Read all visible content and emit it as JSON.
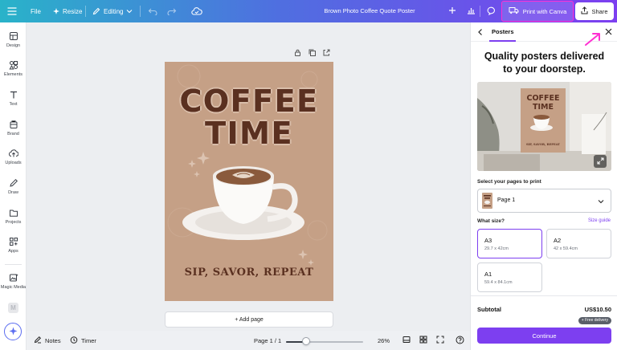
{
  "topbar": {
    "file_label": "File",
    "resize_label": "Resize",
    "editing_label": "Editing",
    "doc_title": "Brown Photo Coffee Quote Poster",
    "print_label": "Print with Canva",
    "share_label": "Share"
  },
  "sidebar": {
    "items": [
      {
        "label": "Design",
        "icon": "design-icon"
      },
      {
        "label": "Elements",
        "icon": "elements-icon"
      },
      {
        "label": "Text",
        "icon": "text-icon"
      },
      {
        "label": "Brand",
        "icon": "brand-icon"
      },
      {
        "label": "Uploads",
        "icon": "uploads-icon"
      },
      {
        "label": "Draw",
        "icon": "draw-icon"
      },
      {
        "label": "Projects",
        "icon": "projects-icon"
      },
      {
        "label": "Apps",
        "icon": "apps-icon"
      },
      {
        "label": "Magic Media",
        "icon": "magic-media-icon"
      }
    ]
  },
  "poster": {
    "title_line1": "COFFEE",
    "title_line2": "TIME",
    "subtitle": "SIP, SAVOR, REPEAT"
  },
  "canvas": {
    "add_page_label": "+ Add page"
  },
  "bottombar": {
    "notes_label": "Notes",
    "timer_label": "Timer",
    "page_indicator": "Page 1 / 1",
    "zoom_label": "26%",
    "zoom_fraction": 0.26
  },
  "panel": {
    "tab_label": "Posters",
    "headline_line1": "Quality posters delivered",
    "headline_line2": "to your doorstep.",
    "preview_poster_line1": "COFFEE",
    "preview_poster_line2": "TIME",
    "preview_poster_sub": "SIP, SAVOR, REPEAT",
    "select_pages_label": "Select your pages to print",
    "selected_page": "Page 1",
    "what_size_label": "What size?",
    "size_guide_label": "Size guide",
    "sizes": [
      {
        "name": "A3",
        "dims": "29.7 x 42cm",
        "selected": true
      },
      {
        "name": "A2",
        "dims": "42 x 59.4cm",
        "selected": false
      },
      {
        "name": "A1",
        "dims": "59.4 x 84.1cm",
        "selected": false
      }
    ],
    "subtotal_label": "Subtotal",
    "subtotal_value": "US$10.50",
    "free_delivery_label": "+ Free delivery",
    "continue_label": "Continue"
  },
  "colors": {
    "accent": "#7d3ff0",
    "poster_bg": "#c5a086",
    "poster_text": "#5a3020",
    "highlight": "#ff2fd2"
  }
}
